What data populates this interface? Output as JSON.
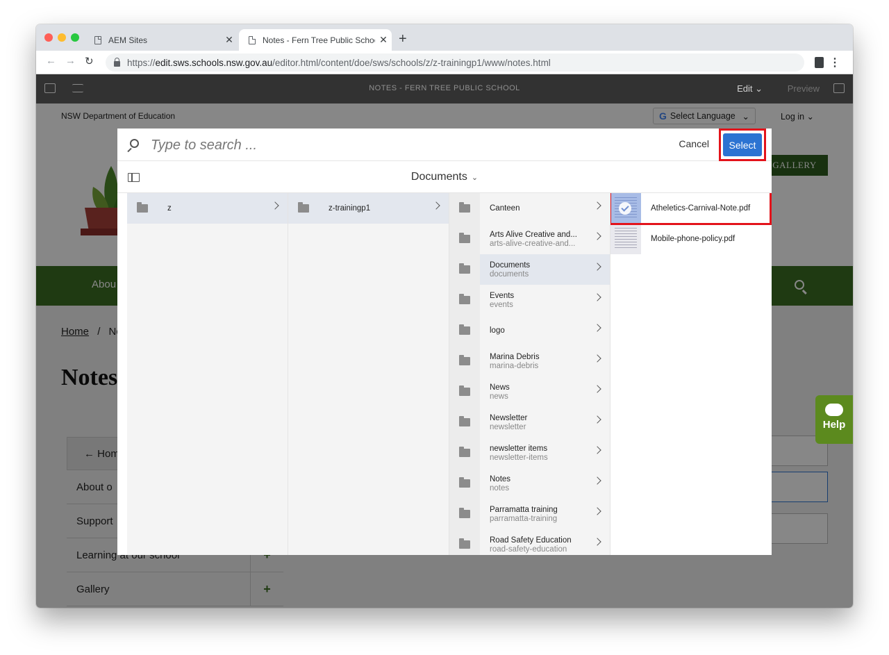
{
  "browser": {
    "tabs": [
      {
        "title": "AEM Sites"
      },
      {
        "title": "Notes - Fern Tree Public Schoo"
      }
    ],
    "url_scheme": "https://",
    "url_host": "edit.sws.schools.nsw.gov.au",
    "url_path": "/editor.html/content/doe/sws/schools/z/z-trainingp1/www/notes.html"
  },
  "editor": {
    "page_title": "NOTES - FERN TREE PUBLIC SCHOOL",
    "edit_label": "Edit",
    "preview_label": "Preview"
  },
  "site": {
    "org": "NSW Department of Education",
    "language_label": "Select Language",
    "login_label": "Log in",
    "gallery_label": "GALLERY",
    "nav_about": "Abou",
    "crumb_home": "Home",
    "crumb_sep": "/",
    "crumb_current": "Nc",
    "title": "Notes",
    "side_home": "Hom",
    "side_items": [
      "About o",
      "Support",
      "Learning at our school",
      "Gallery"
    ],
    "help_label": "Help"
  },
  "picker": {
    "search_placeholder": "Type to search ...",
    "cancel_label": "Cancel",
    "select_label": "Select",
    "location_title": "Documents",
    "col1": [
      {
        "title": "z"
      }
    ],
    "col2": [
      {
        "title": "z-trainingp1"
      }
    ],
    "col3": [
      {
        "title": "Canteen",
        "sub": ""
      },
      {
        "title": "Arts Alive Creative and...",
        "sub": "arts-alive-creative-and..."
      },
      {
        "title": "Documents",
        "sub": "documents"
      },
      {
        "title": "Events",
        "sub": "events"
      },
      {
        "title": "logo",
        "sub": ""
      },
      {
        "title": "Marina Debris",
        "sub": "marina-debris"
      },
      {
        "title": "News",
        "sub": "news"
      },
      {
        "title": "Newsletter",
        "sub": "newsletter"
      },
      {
        "title": "newsletter items",
        "sub": "newsletter-items"
      },
      {
        "title": "Notes",
        "sub": "notes"
      },
      {
        "title": "Parramatta training",
        "sub": "parramatta-training"
      },
      {
        "title": "Road Safety Education",
        "sub": "road-safety-education"
      }
    ],
    "files": [
      {
        "name": "Atheletics-Carnival-Note.pdf"
      },
      {
        "name": "Mobile-phone-policy.pdf"
      }
    ]
  },
  "colors": {
    "select_blue": "#2c73d2",
    "highlight_red": "#e3131b",
    "site_green": "#3c6e23"
  }
}
